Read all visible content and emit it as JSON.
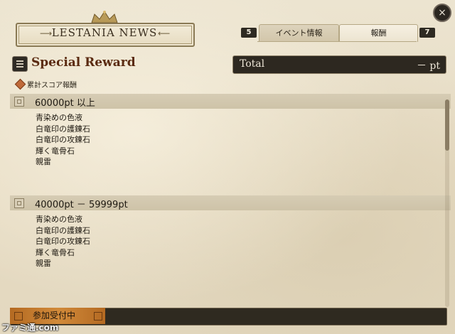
{
  "header": {
    "logo_text": "LESTANIA NEWS",
    "close_label": "×"
  },
  "tabs": {
    "prev_page": "5",
    "next_page": "7",
    "items": [
      {
        "label": "イベント情報",
        "active": false
      },
      {
        "label": "報酬",
        "active": true
      }
    ]
  },
  "title": "Special Reward",
  "total": {
    "label": "Total",
    "value": "－ pt"
  },
  "subheader": "累計スコア報酬",
  "tiers": [
    {
      "title": "60000pt 以上",
      "rewards": [
        "青染めの色液",
        "白竜印の護錬石",
        "白竜印の攻錬石",
        "輝く竜骨石",
        "親雷"
      ]
    },
    {
      "title": "40000pt － 59999pt",
      "rewards": [
        "青染めの色液",
        "白竜印の護錬石",
        "白竜印の攻錬石",
        "輝く竜骨石",
        "親雷"
      ]
    }
  ],
  "footer": {
    "status": "参加受付中"
  },
  "watermark": "ファミ通.com",
  "colors": {
    "title": "#5a2a10",
    "footer_status": "#d18a3a",
    "panel_bg": "#e7dcc4"
  }
}
